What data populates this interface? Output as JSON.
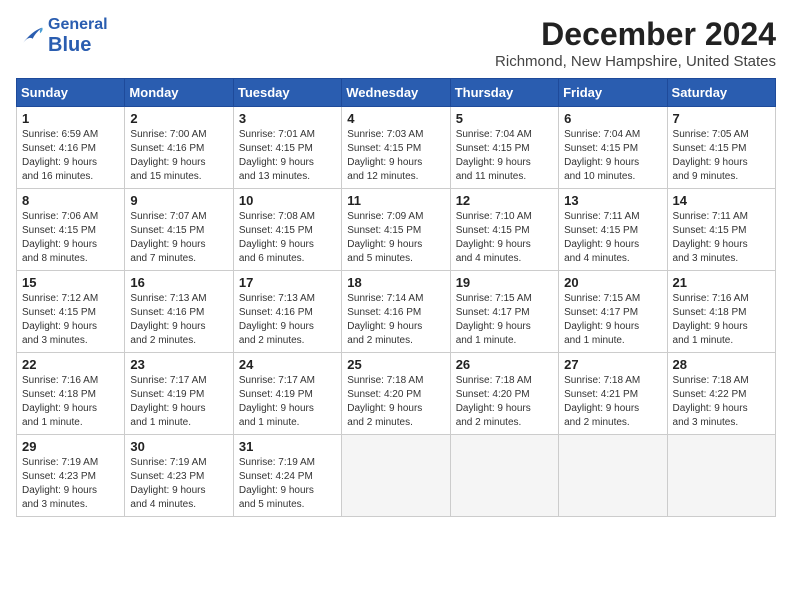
{
  "header": {
    "logo_line1": "General",
    "logo_line2": "Blue",
    "month": "December 2024",
    "location": "Richmond, New Hampshire, United States"
  },
  "columns": [
    "Sunday",
    "Monday",
    "Tuesday",
    "Wednesday",
    "Thursday",
    "Friday",
    "Saturday"
  ],
  "weeks": [
    [
      {
        "day": "1",
        "detail": "Sunrise: 6:59 AM\nSunset: 4:16 PM\nDaylight: 9 hours\nand 16 minutes."
      },
      {
        "day": "2",
        "detail": "Sunrise: 7:00 AM\nSunset: 4:16 PM\nDaylight: 9 hours\nand 15 minutes."
      },
      {
        "day": "3",
        "detail": "Sunrise: 7:01 AM\nSunset: 4:15 PM\nDaylight: 9 hours\nand 13 minutes."
      },
      {
        "day": "4",
        "detail": "Sunrise: 7:03 AM\nSunset: 4:15 PM\nDaylight: 9 hours\nand 12 minutes."
      },
      {
        "day": "5",
        "detail": "Sunrise: 7:04 AM\nSunset: 4:15 PM\nDaylight: 9 hours\nand 11 minutes."
      },
      {
        "day": "6",
        "detail": "Sunrise: 7:04 AM\nSunset: 4:15 PM\nDaylight: 9 hours\nand 10 minutes."
      },
      {
        "day": "7",
        "detail": "Sunrise: 7:05 AM\nSunset: 4:15 PM\nDaylight: 9 hours\nand 9 minutes."
      }
    ],
    [
      {
        "day": "8",
        "detail": "Sunrise: 7:06 AM\nSunset: 4:15 PM\nDaylight: 9 hours\nand 8 minutes."
      },
      {
        "day": "9",
        "detail": "Sunrise: 7:07 AM\nSunset: 4:15 PM\nDaylight: 9 hours\nand 7 minutes."
      },
      {
        "day": "10",
        "detail": "Sunrise: 7:08 AM\nSunset: 4:15 PM\nDaylight: 9 hours\nand 6 minutes."
      },
      {
        "day": "11",
        "detail": "Sunrise: 7:09 AM\nSunset: 4:15 PM\nDaylight: 9 hours\nand 5 minutes."
      },
      {
        "day": "12",
        "detail": "Sunrise: 7:10 AM\nSunset: 4:15 PM\nDaylight: 9 hours\nand 4 minutes."
      },
      {
        "day": "13",
        "detail": "Sunrise: 7:11 AM\nSunset: 4:15 PM\nDaylight: 9 hours\nand 4 minutes."
      },
      {
        "day": "14",
        "detail": "Sunrise: 7:11 AM\nSunset: 4:15 PM\nDaylight: 9 hours\nand 3 minutes."
      }
    ],
    [
      {
        "day": "15",
        "detail": "Sunrise: 7:12 AM\nSunset: 4:15 PM\nDaylight: 9 hours\nand 3 minutes."
      },
      {
        "day": "16",
        "detail": "Sunrise: 7:13 AM\nSunset: 4:16 PM\nDaylight: 9 hours\nand 2 minutes."
      },
      {
        "day": "17",
        "detail": "Sunrise: 7:13 AM\nSunset: 4:16 PM\nDaylight: 9 hours\nand 2 minutes."
      },
      {
        "day": "18",
        "detail": "Sunrise: 7:14 AM\nSunset: 4:16 PM\nDaylight: 9 hours\nand 2 minutes."
      },
      {
        "day": "19",
        "detail": "Sunrise: 7:15 AM\nSunset: 4:17 PM\nDaylight: 9 hours\nand 1 minute."
      },
      {
        "day": "20",
        "detail": "Sunrise: 7:15 AM\nSunset: 4:17 PM\nDaylight: 9 hours\nand 1 minute."
      },
      {
        "day": "21",
        "detail": "Sunrise: 7:16 AM\nSunset: 4:18 PM\nDaylight: 9 hours\nand 1 minute."
      }
    ],
    [
      {
        "day": "22",
        "detail": "Sunrise: 7:16 AM\nSunset: 4:18 PM\nDaylight: 9 hours\nand 1 minute."
      },
      {
        "day": "23",
        "detail": "Sunrise: 7:17 AM\nSunset: 4:19 PM\nDaylight: 9 hours\nand 1 minute."
      },
      {
        "day": "24",
        "detail": "Sunrise: 7:17 AM\nSunset: 4:19 PM\nDaylight: 9 hours\nand 1 minute."
      },
      {
        "day": "25",
        "detail": "Sunrise: 7:18 AM\nSunset: 4:20 PM\nDaylight: 9 hours\nand 2 minutes."
      },
      {
        "day": "26",
        "detail": "Sunrise: 7:18 AM\nSunset: 4:20 PM\nDaylight: 9 hours\nand 2 minutes."
      },
      {
        "day": "27",
        "detail": "Sunrise: 7:18 AM\nSunset: 4:21 PM\nDaylight: 9 hours\nand 2 minutes."
      },
      {
        "day": "28",
        "detail": "Sunrise: 7:18 AM\nSunset: 4:22 PM\nDaylight: 9 hours\nand 3 minutes."
      }
    ],
    [
      {
        "day": "29",
        "detail": "Sunrise: 7:19 AM\nSunset: 4:23 PM\nDaylight: 9 hours\nand 3 minutes."
      },
      {
        "day": "30",
        "detail": "Sunrise: 7:19 AM\nSunset: 4:23 PM\nDaylight: 9 hours\nand 4 minutes."
      },
      {
        "day": "31",
        "detail": "Sunrise: 7:19 AM\nSunset: 4:24 PM\nDaylight: 9 hours\nand 5 minutes."
      },
      null,
      null,
      null,
      null
    ]
  ]
}
